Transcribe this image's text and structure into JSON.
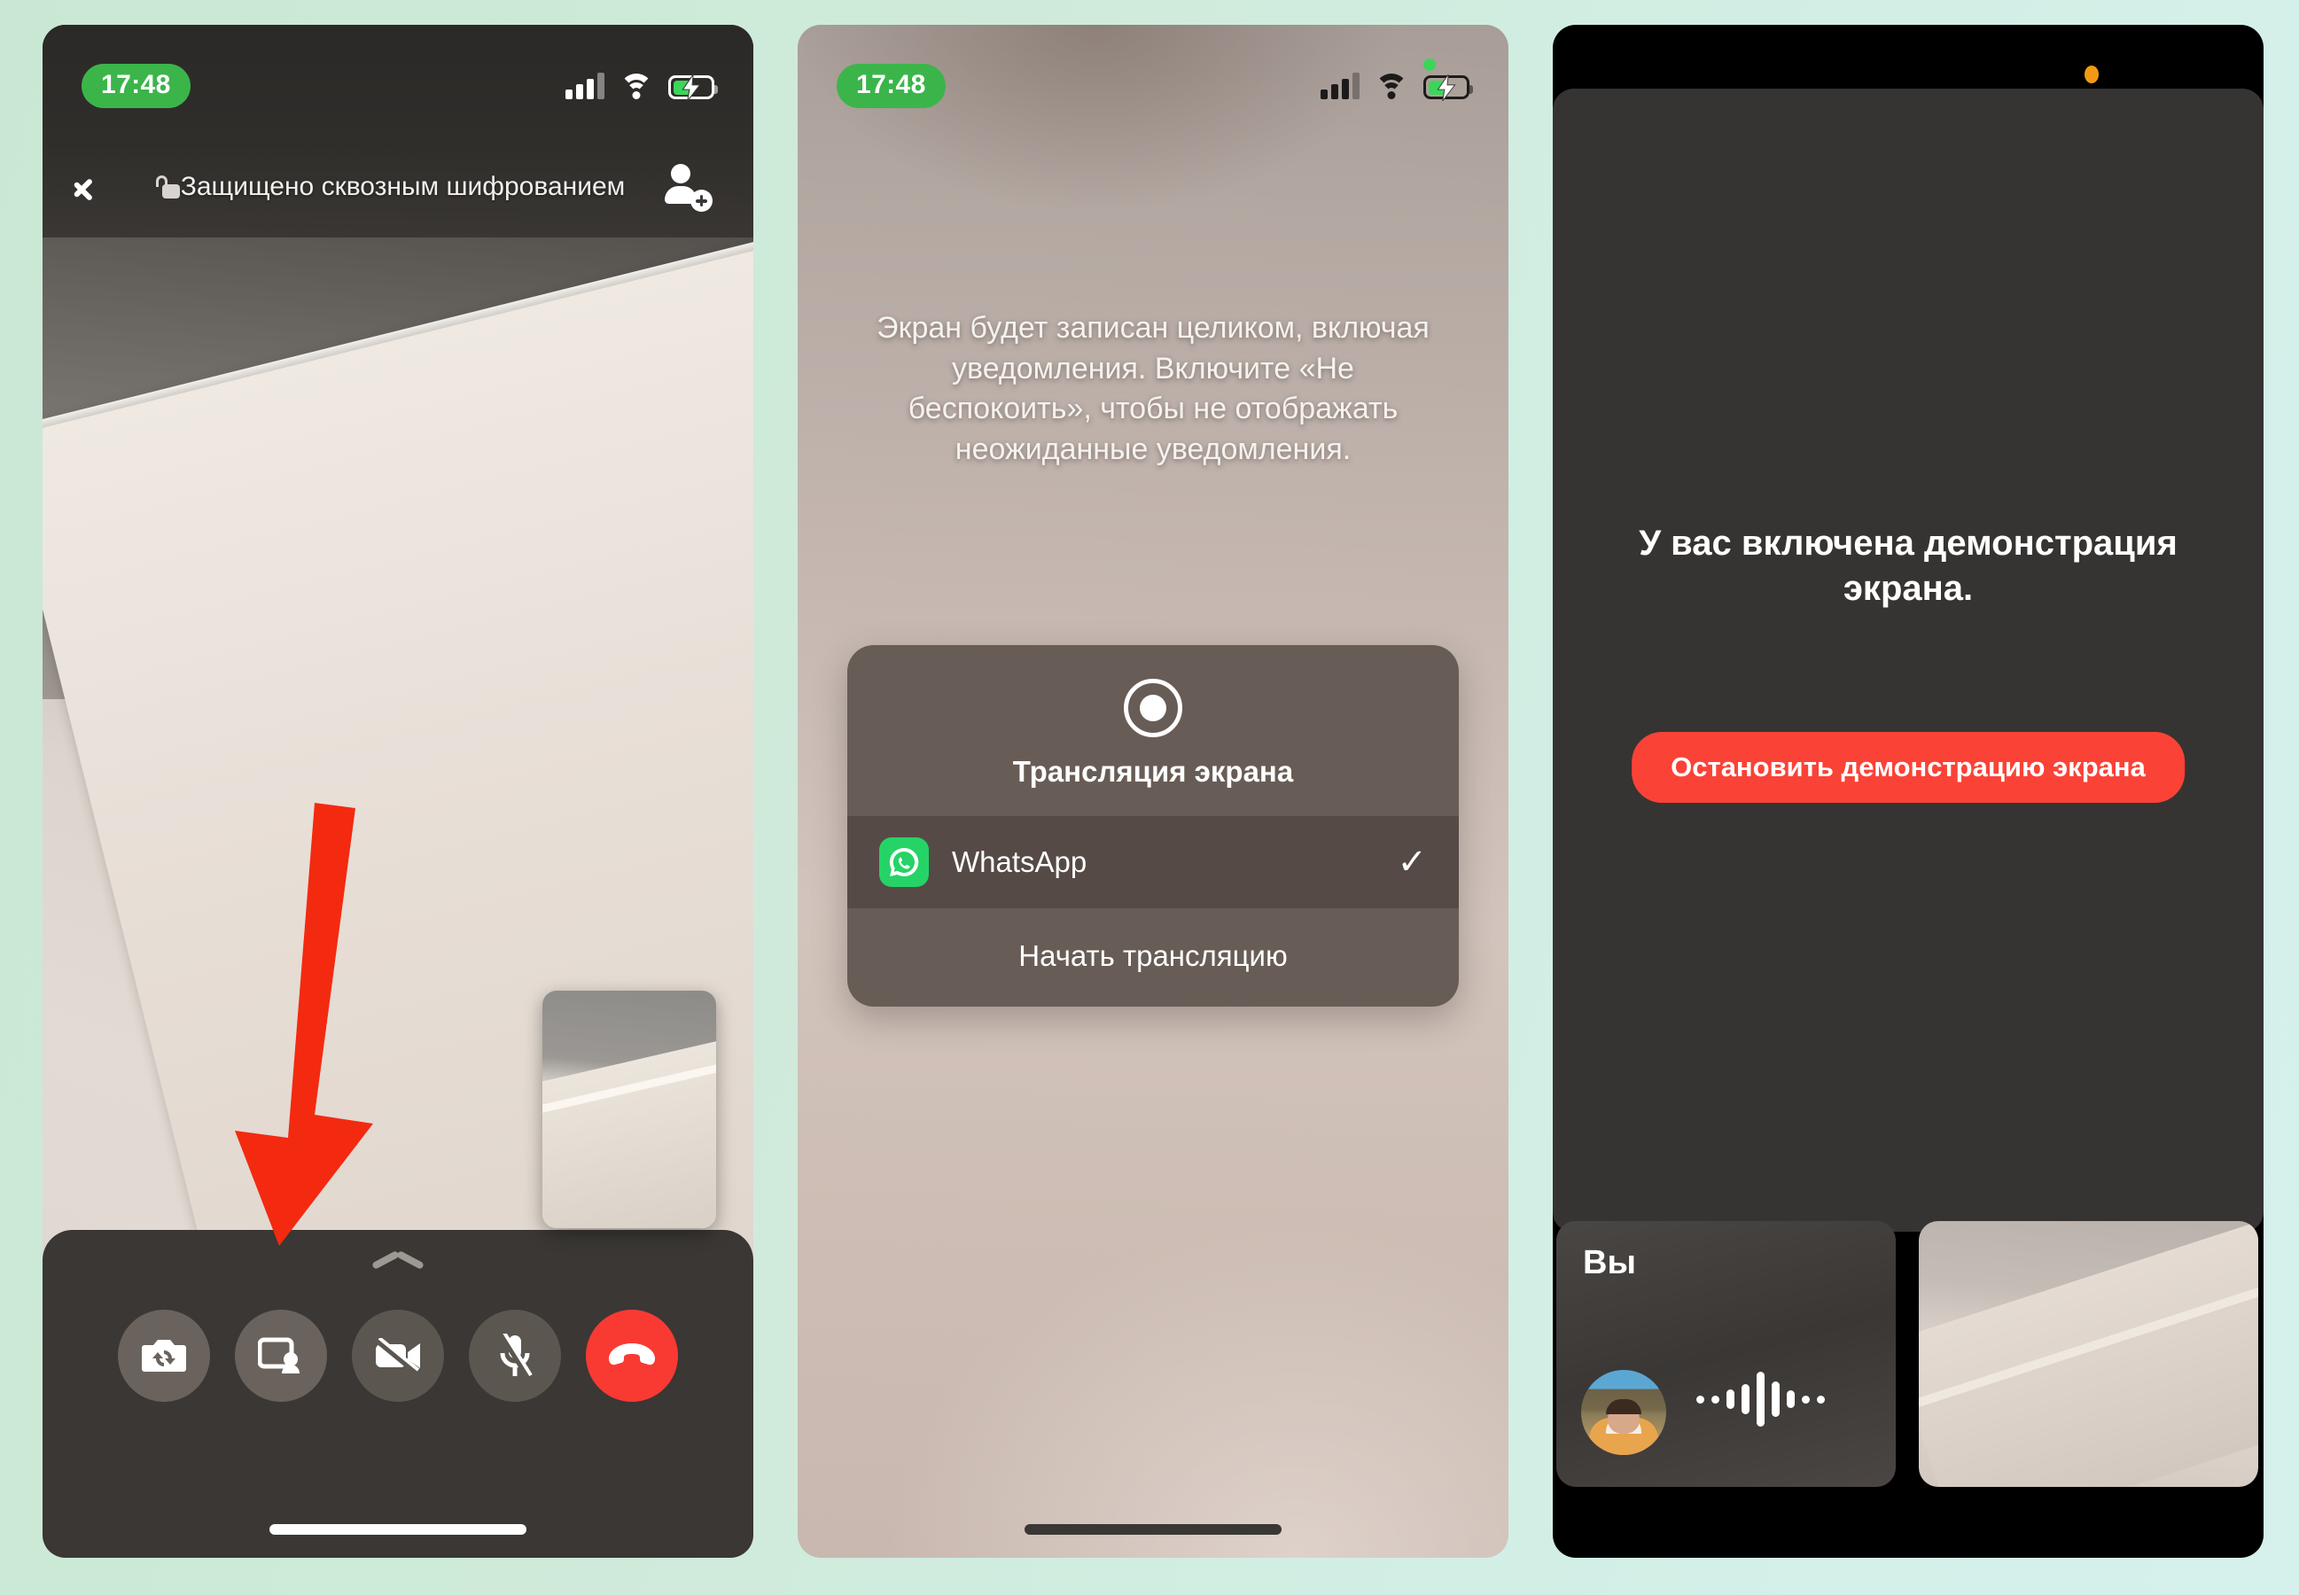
{
  "background_color": "#cfead9",
  "panels": [
    {
      "id": "call-screen",
      "status_bar": {
        "time": "17:48",
        "icons": [
          "cellular-signal-icon",
          "wifi-icon",
          "battery-charging-icon"
        ]
      },
      "header": {
        "title": "Защищено сквозным шифрованием",
        "lock_icon": "lock-icon",
        "back_icon": "back-chevron-icon",
        "add_icon": "add-person-icon"
      },
      "controls": [
        {
          "name": "flip-camera-button",
          "icon": "camera-flip-icon",
          "color": "#6a635d"
        },
        {
          "name": "share-screen-button",
          "icon": "screen-share-icon",
          "color": "#6a635d"
        },
        {
          "name": "video-off-button",
          "icon": "video-off-icon",
          "color": "#5c5650"
        },
        {
          "name": "mute-button",
          "icon": "mic-off-icon",
          "color": "#5c5650"
        },
        {
          "name": "end-call-button",
          "icon": "end-call-icon",
          "color": "#f83a33"
        }
      ],
      "annotation": {
        "type": "red-arrow",
        "color": "#f32a10",
        "points_to": "share-screen-button"
      }
    },
    {
      "id": "broadcast-sheet",
      "status_bar": {
        "time": "17:48",
        "icons": [
          "cellular-signal-icon",
          "wifi-icon",
          "battery-charging-icon",
          "recording-dot"
        ]
      },
      "notice": "Экран будет записан целиком, включая уведомления. Включите «Не беспокоить», чтобы не отображать неожиданные уведомления.",
      "sheet": {
        "icon": "record-circle-icon",
        "title": "Трансляция экрана",
        "app_row": {
          "label": "WhatsApp",
          "icon": "whatsapp-icon",
          "selected": true,
          "check": "✓",
          "icon_color": "#25d366"
        },
        "start_label": "Начать трансляцию"
      }
    },
    {
      "id": "sharing-active",
      "status_bar": {
        "icons": [
          "privacy-dot"
        ],
        "privacy_dot_color": "#f09a14"
      },
      "message": "У вас включена демонстрация экрана.",
      "stop_button": {
        "label": "Остановить демонстрацию экрана",
        "color": "#fb4237"
      },
      "tiles": [
        {
          "name": "self-tile",
          "label": "Вы",
          "avatar": "user-avatar",
          "waveform": "audio-waveform-icon"
        },
        {
          "name": "remote-video-tile",
          "label": ""
        }
      ]
    }
  ]
}
